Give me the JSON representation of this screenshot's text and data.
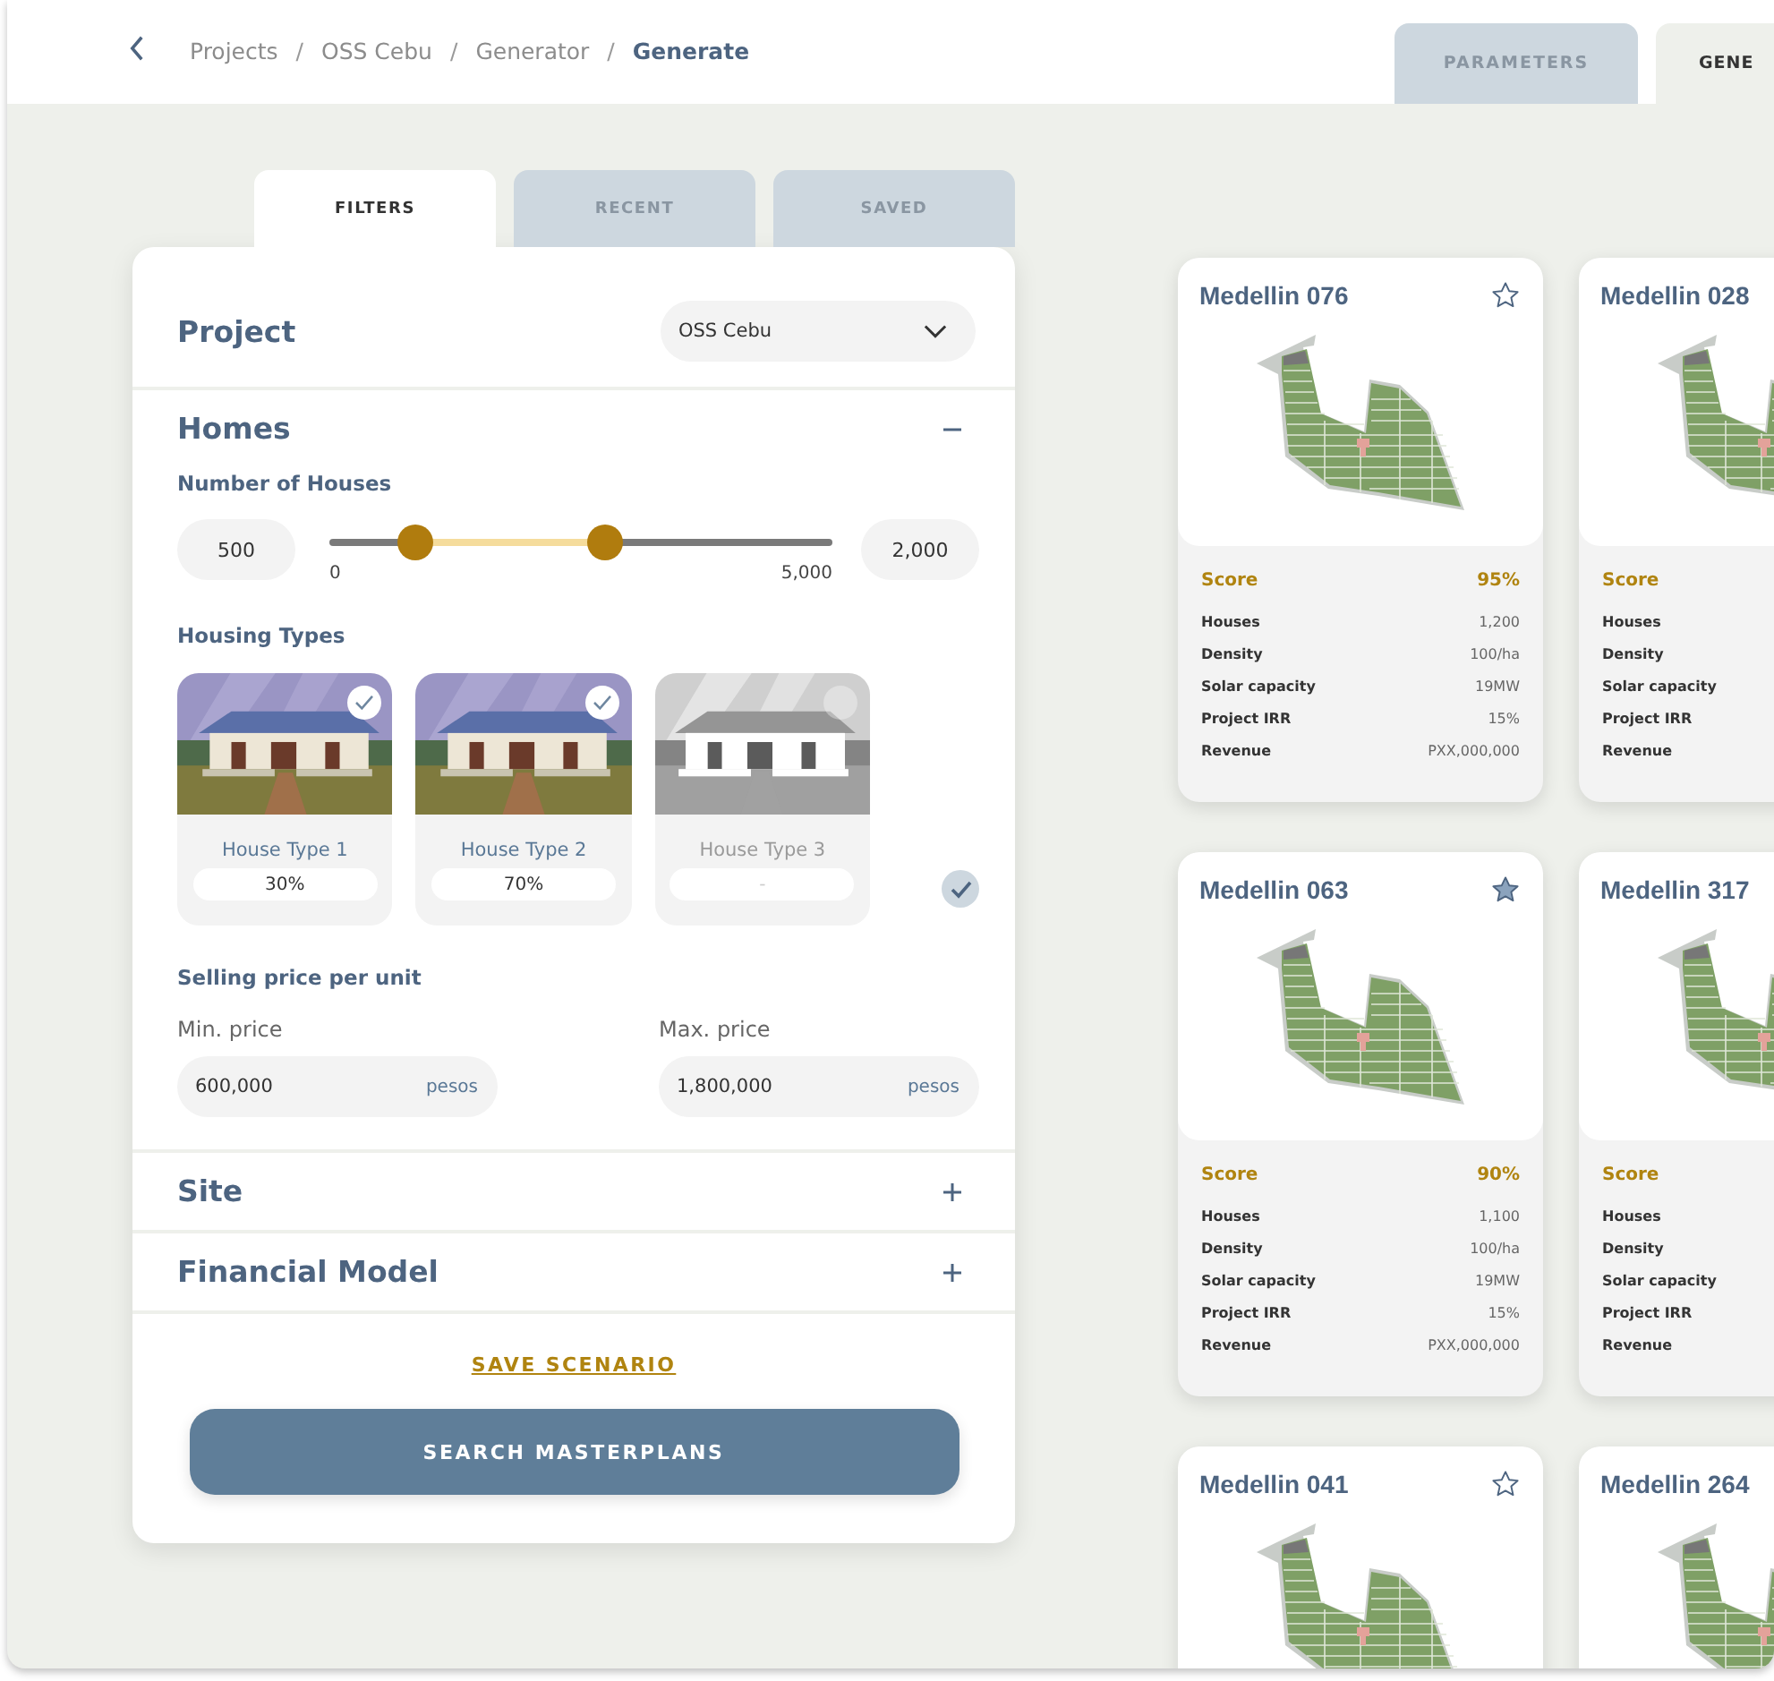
{
  "breadcrumb": [
    {
      "label": "Projects",
      "current": false
    },
    {
      "separator": "/",
      "label": "OSS Cebu",
      "current": false
    },
    {
      "separator": "/",
      "label": "Generator",
      "current": false
    },
    {
      "separator": "/",
      "label": "Generate",
      "current": true
    }
  ],
  "top_tabs": [
    {
      "label": "PARAMETERS",
      "selected": false
    },
    {
      "label": "GENE",
      "selected": true
    }
  ],
  "panel_tabs": [
    {
      "label": "FILTERS",
      "selected": true
    },
    {
      "label": "RECENT",
      "selected": false
    },
    {
      "label": "SAVED",
      "selected": false
    }
  ],
  "project": {
    "label": "Project",
    "value": "OSS Cebu"
  },
  "sections": [
    {
      "title": "Homes",
      "expanded": true
    },
    {
      "title": "Site",
      "expanded": false
    },
    {
      "title": "Financial Model",
      "expanded": false
    }
  ],
  "houses": {
    "label": "Number of Houses",
    "min_value": "500",
    "max_value": "2,000",
    "range_min": "0",
    "range_max": "5,000",
    "thumbs": [
      {
        "level": 0.16
      },
      {
        "level": 0.51
      }
    ]
  },
  "housing_types": {
    "label": "Housing Types",
    "all_selected": true,
    "items": [
      {
        "name": "House Type 1",
        "share": "30%",
        "selected": true
      },
      {
        "name": "House Type 2",
        "share": "70%",
        "selected": true
      },
      {
        "name": "House Type 3",
        "share": "-",
        "selected": false
      }
    ]
  },
  "price": {
    "label": "Selling price per unit",
    "fields": [
      {
        "label": "Min. price",
        "value": "600,000",
        "unit": "pesos"
      },
      {
        "label": "Max. price",
        "value": "1,800,000",
        "unit": "pesos"
      }
    ]
  },
  "save_link": "SAVE SCENARIO",
  "search_button": "SEARCH MASTERPLANS",
  "results": [
    {
      "title": "Medellin 076",
      "favorite": false,
      "score_label": "Score",
      "score": "95%",
      "metrics": [
        {
          "label": "Houses",
          "value": "1,200"
        },
        {
          "label": "Density",
          "value": "100/ha"
        },
        {
          "label": "Solar capacity",
          "value": "19MW"
        },
        {
          "label": "Project IRR",
          "value": "15%"
        },
        {
          "label": "Revenue",
          "value": "PXX,000,000"
        }
      ]
    },
    {
      "title": "Medellin 028",
      "score_label": "Score",
      "metrics": [
        {
          "label": "Houses"
        },
        {
          "label": "Density"
        },
        {
          "label": "Solar capacity"
        },
        {
          "label": "Project IRR"
        },
        {
          "label": "Revenue"
        }
      ]
    },
    {
      "title": "Medellin 063",
      "favorite": true,
      "score_label": "Score",
      "score": "90%",
      "metrics": [
        {
          "label": "Houses",
          "value": "1,100"
        },
        {
          "label": "Density",
          "value": "100/ha"
        },
        {
          "label": "Solar capacity",
          "value": "19MW"
        },
        {
          "label": "Project IRR",
          "value": "15%"
        },
        {
          "label": "Revenue",
          "value": "PXX,000,000"
        }
      ]
    },
    {
      "title": "Medellin 317",
      "score_label": "Score",
      "metrics": [
        {
          "label": "Houses"
        },
        {
          "label": "Density"
        },
        {
          "label": "Solar capacity"
        },
        {
          "label": "Project IRR"
        },
        {
          "label": "Revenue"
        }
      ]
    },
    {
      "title": "Medellin 041",
      "favorite": false
    },
    {
      "title": "Medellin 264"
    }
  ]
}
